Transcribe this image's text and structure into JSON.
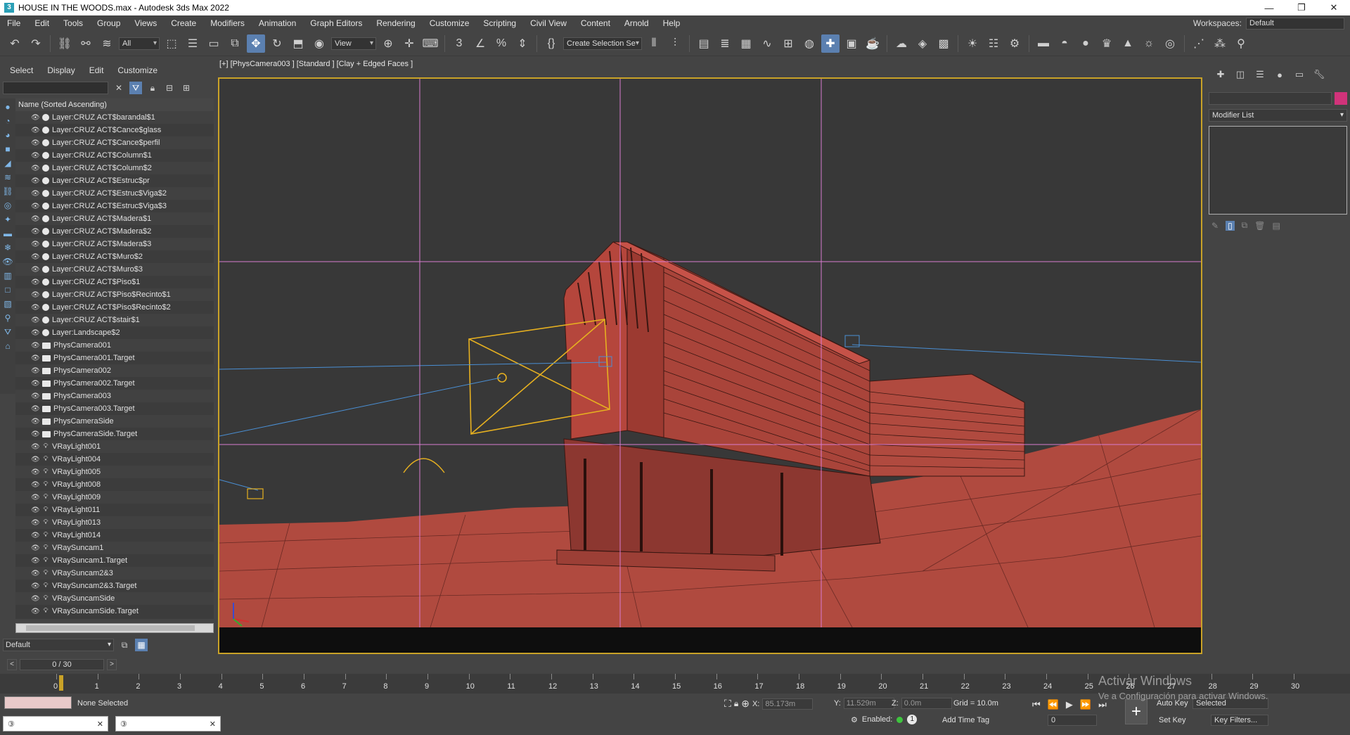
{
  "window": {
    "title": "HOUSE IN THE WOODS.max - Autodesk 3ds Max 2022",
    "app_icon": "3ds-max-icon",
    "controls": [
      "—",
      "❐",
      "✕"
    ]
  },
  "menu": {
    "items": [
      "File",
      "Edit",
      "Tools",
      "Group",
      "Views",
      "Create",
      "Modifiers",
      "Animation",
      "Graph Editors",
      "Rendering",
      "Customize",
      "Scripting",
      "Civil View",
      "Content",
      "Arnold",
      "Help"
    ],
    "workspace_label": "Workspaces:",
    "workspace_value": "Default"
  },
  "toolbar": {
    "selection_filter": "All",
    "reference_coord": "View",
    "named_selection": "Create Selection Se"
  },
  "explorer": {
    "tabs": [
      "Select",
      "Display",
      "Edit",
      "Customize"
    ],
    "column_header": "Name (Sorted Ascending)",
    "rows": [
      {
        "name": "Layer:CRUZ ACT$barandal$1",
        "type": "layer"
      },
      {
        "name": "Layer:CRUZ ACT$Cance$glass",
        "type": "layer"
      },
      {
        "name": "Layer:CRUZ ACT$Cance$perfil",
        "type": "layer"
      },
      {
        "name": "Layer:CRUZ ACT$Column$1",
        "type": "layer"
      },
      {
        "name": "Layer:CRUZ ACT$Column$2",
        "type": "layer"
      },
      {
        "name": "Layer:CRUZ ACT$Estruc$pr",
        "type": "layer"
      },
      {
        "name": "Layer:CRUZ ACT$Estruc$Viga$2",
        "type": "layer"
      },
      {
        "name": "Layer:CRUZ ACT$Estruc$Viga$3",
        "type": "layer"
      },
      {
        "name": "Layer:CRUZ ACT$Madera$1",
        "type": "layer"
      },
      {
        "name": "Layer:CRUZ ACT$Madera$2",
        "type": "layer"
      },
      {
        "name": "Layer:CRUZ ACT$Madera$3",
        "type": "layer"
      },
      {
        "name": "Layer:CRUZ ACT$Muro$2",
        "type": "layer"
      },
      {
        "name": "Layer:CRUZ ACT$Muro$3",
        "type": "layer"
      },
      {
        "name": "Layer:CRUZ ACT$Piso$1",
        "type": "layer"
      },
      {
        "name": "Layer:CRUZ ACT$Piso$Recinto$1",
        "type": "layer"
      },
      {
        "name": "Layer:CRUZ ACT$Piso$Recinto$2",
        "type": "layer"
      },
      {
        "name": "Layer:CRUZ ACT$stair$1",
        "type": "layer"
      },
      {
        "name": "Layer:Landscape$2",
        "type": "layer"
      },
      {
        "name": "PhysCamera001",
        "type": "camera"
      },
      {
        "name": "PhysCamera001.Target",
        "type": "camera"
      },
      {
        "name": "PhysCamera002",
        "type": "camera"
      },
      {
        "name": "PhysCamera002.Target",
        "type": "camera"
      },
      {
        "name": "PhysCamera003",
        "type": "camera"
      },
      {
        "name": "PhysCamera003.Target",
        "type": "camera"
      },
      {
        "name": "PhysCameraSide",
        "type": "camera"
      },
      {
        "name": "PhysCameraSide.Target",
        "type": "camera"
      },
      {
        "name": "VRayLight001",
        "type": "light"
      },
      {
        "name": "VRayLight004",
        "type": "light"
      },
      {
        "name": "VRayLight005",
        "type": "light"
      },
      {
        "name": "VRayLight008",
        "type": "light"
      },
      {
        "name": "VRayLight009",
        "type": "light"
      },
      {
        "name": "VRayLight011",
        "type": "light"
      },
      {
        "name": "VRayLight013",
        "type": "light"
      },
      {
        "name": "VRayLight014",
        "type": "light"
      },
      {
        "name": "VRaySuncam1",
        "type": "light"
      },
      {
        "name": "VRaySuncam1.Target",
        "type": "light"
      },
      {
        "name": "VRaySuncam2&3",
        "type": "light"
      },
      {
        "name": "VRaySuncam2&3.Target",
        "type": "light"
      },
      {
        "name": "VRaySuncamSide",
        "type": "light"
      },
      {
        "name": "VRaySuncamSide.Target",
        "type": "light"
      }
    ],
    "layer_dropdown": "Default"
  },
  "viewport": {
    "label": "[+] [PhysCamera003 ] [Standard ] [Clay + Edged Faces ]",
    "border_color": "#c9a227",
    "clay_color": "#b5463c"
  },
  "command_panel": {
    "modifier_list": "Modifier List",
    "object_color": "#d1337a"
  },
  "timeline": {
    "frame_display": "0 / 30",
    "ticks": [
      "0",
      "1",
      "2",
      "3",
      "4",
      "5",
      "6",
      "7",
      "8",
      "9",
      "10",
      "11",
      "12",
      "13",
      "14",
      "15",
      "16",
      "17",
      "18",
      "19",
      "20",
      "21",
      "22",
      "23",
      "24",
      "25",
      "26",
      "27",
      "28",
      "29",
      "30"
    ]
  },
  "status": {
    "selection": "None Selected",
    "x_label": "X:",
    "x_value": "85.173m",
    "y_label": "Y:",
    "y_value": "11.529m",
    "z_label": "Z:",
    "z_value": "0.0m",
    "grid": "Grid = 10.0m",
    "enabled_label": "Enabled:",
    "enabled_count": "1",
    "add_time_tag": "Add Time Tag",
    "frame_value": "0",
    "auto_key": "Auto Key",
    "set_key": "Set Key",
    "key_mode": "Selected",
    "key_filters": "Key Filters...",
    "watermark_title": "Activar Windows",
    "watermark_sub": "Ve a Configuración para activar Windows."
  }
}
